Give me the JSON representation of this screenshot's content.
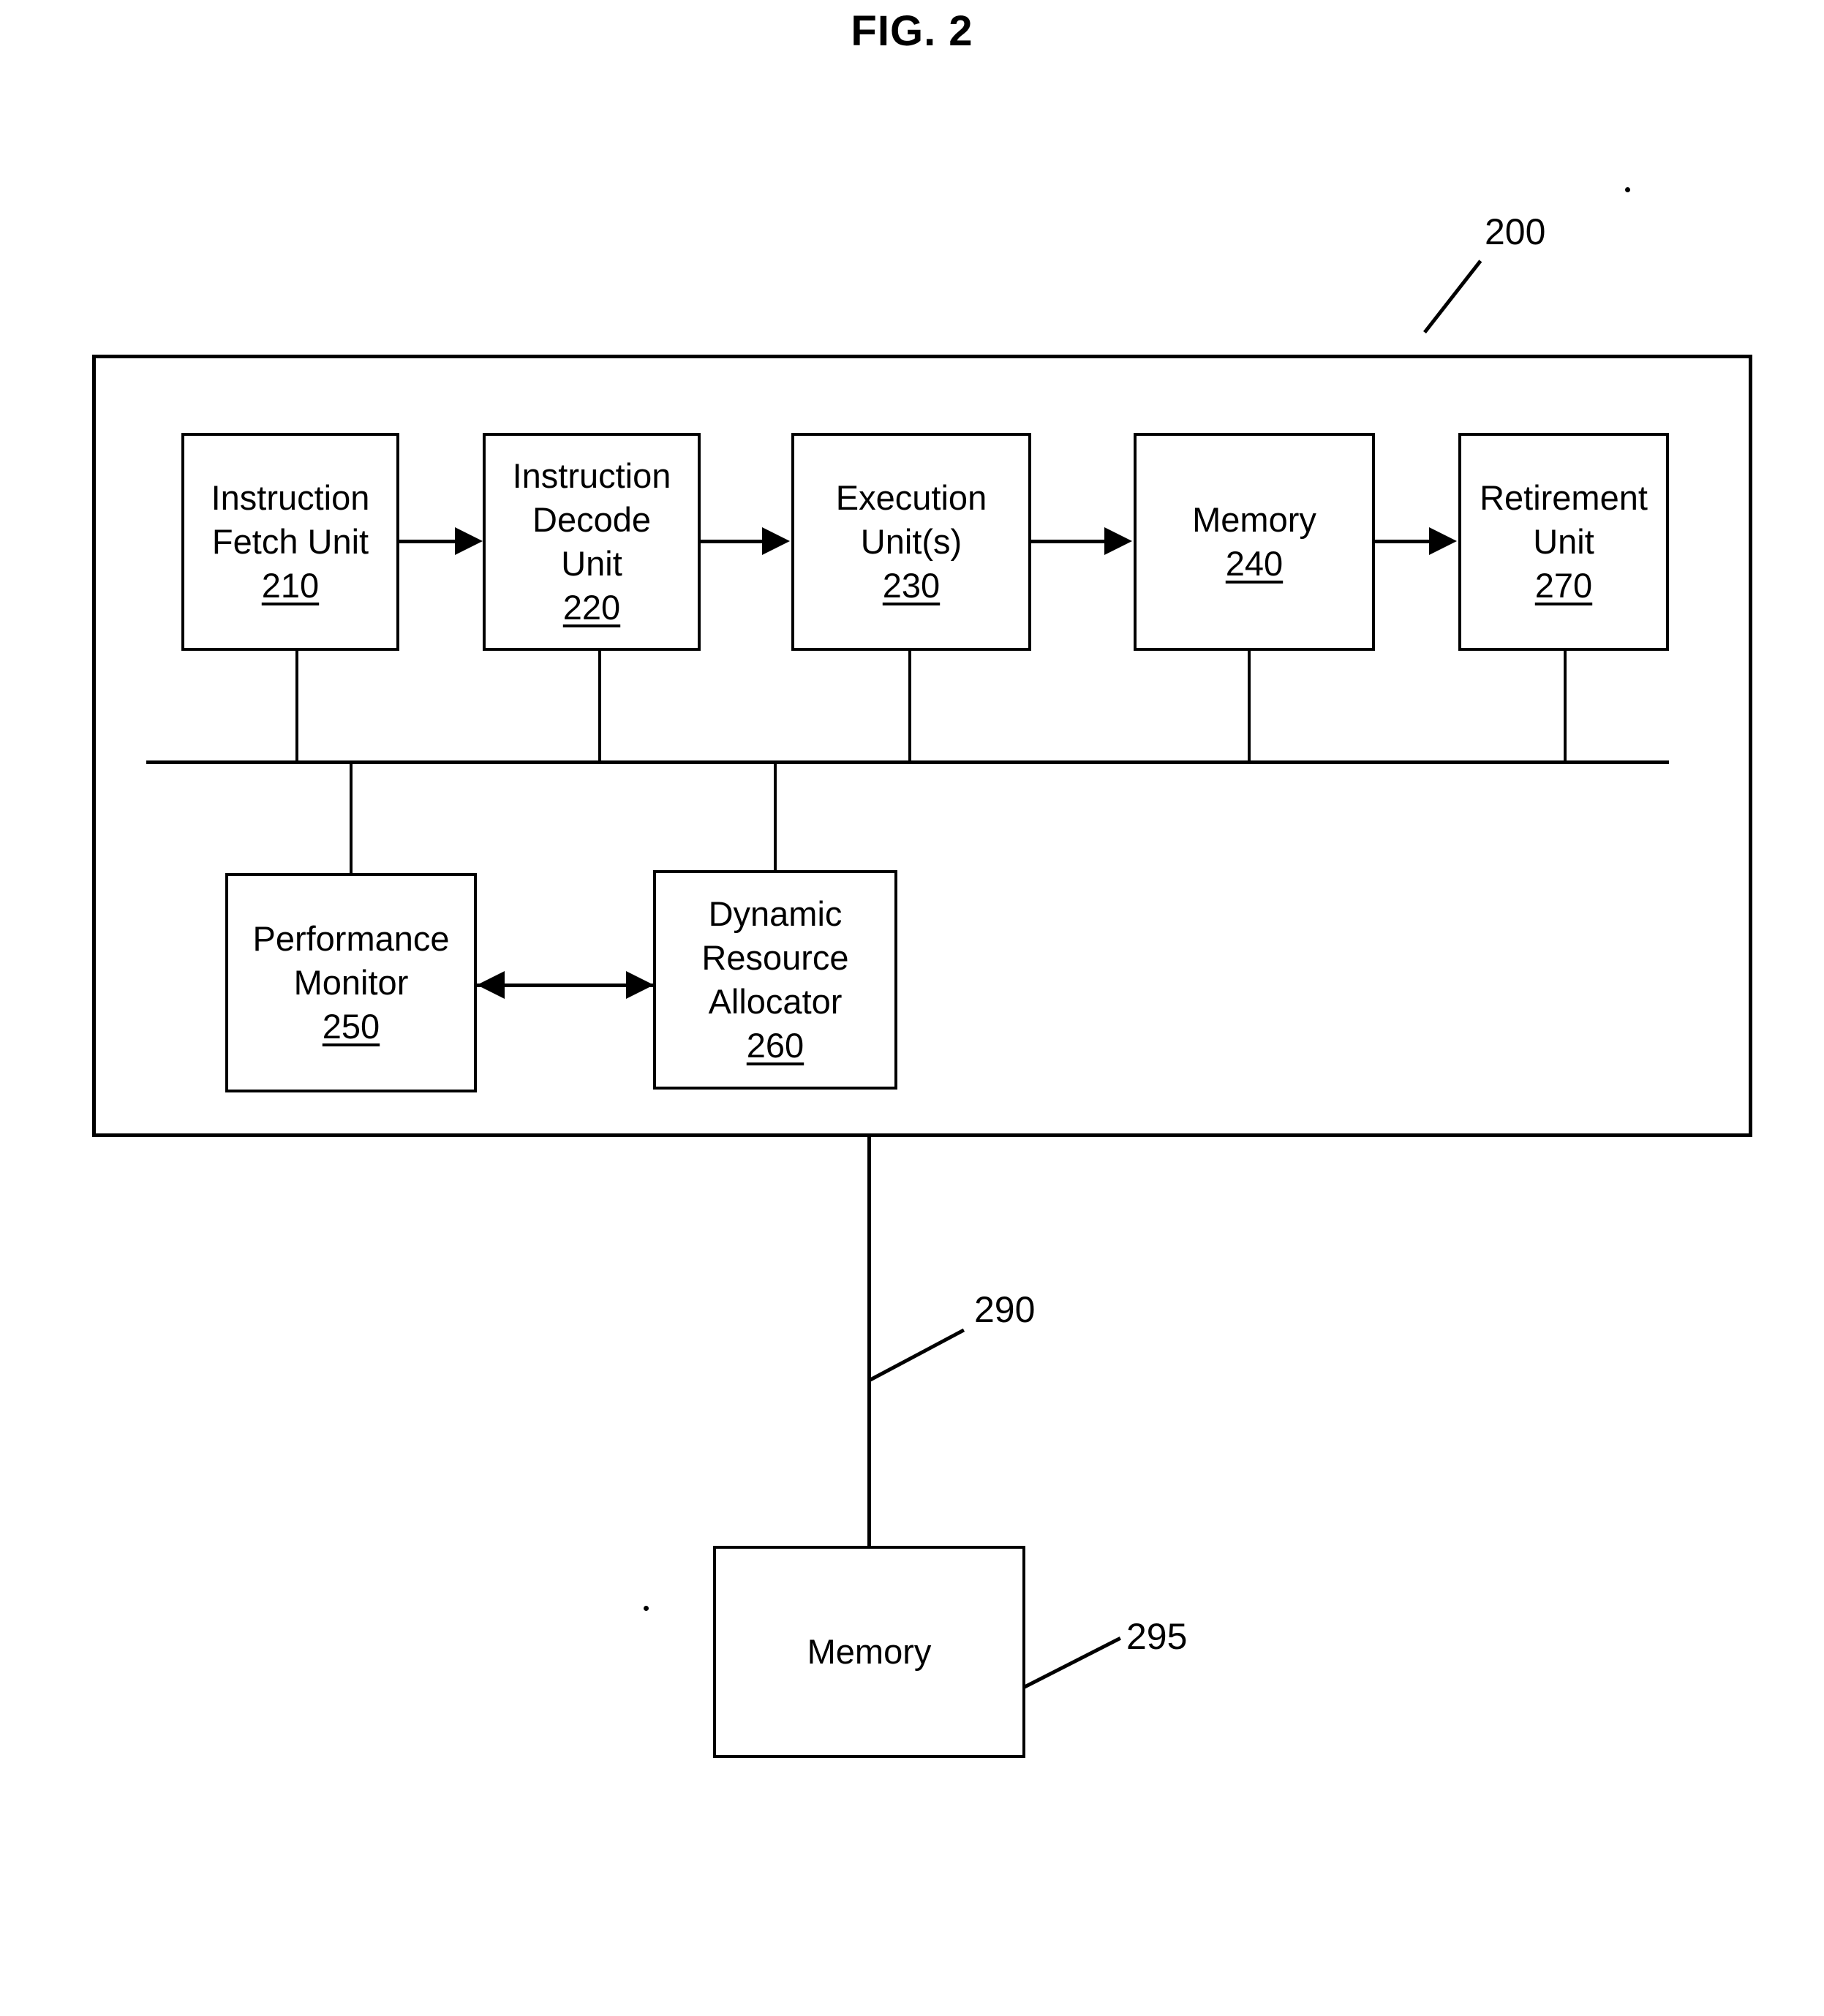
{
  "figure": {
    "title": "FIG. 2"
  },
  "reference_numerals": {
    "system": "200",
    "bus_to_memory": "290",
    "external_memory": "295"
  },
  "pipeline_blocks": [
    {
      "name": "instruction-fetch-unit",
      "lines": [
        "Instruction",
        "Fetch Unit"
      ],
      "number": "210"
    },
    {
      "name": "instruction-decode-unit",
      "lines": [
        "Instruction",
        "Decode",
        "Unit"
      ],
      "number": "220"
    },
    {
      "name": "execution-units",
      "lines": [
        "Execution",
        "Unit(s)"
      ],
      "number": "230"
    },
    {
      "name": "memory",
      "lines": [
        "Memory"
      ],
      "number": "240"
    },
    {
      "name": "retirement-unit",
      "lines": [
        "Retirement",
        "Unit"
      ],
      "number": "270"
    }
  ],
  "control_blocks": [
    {
      "name": "performance-monitor",
      "lines": [
        "Performance",
        "Monitor"
      ],
      "number": "250"
    },
    {
      "name": "dynamic-resource-allocator",
      "lines": [
        "Dynamic",
        "Resource",
        "Allocator"
      ],
      "number": "260"
    }
  ],
  "external_memory_block": {
    "name": "external-memory",
    "lines": [
      "Memory"
    ]
  }
}
